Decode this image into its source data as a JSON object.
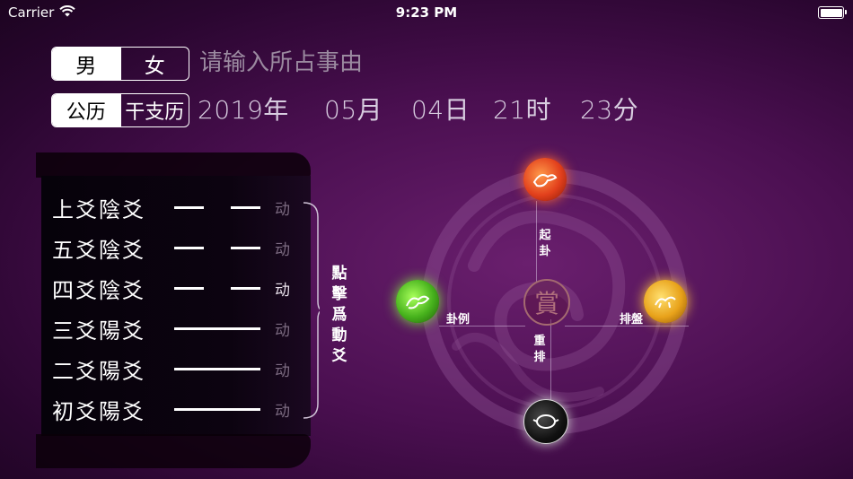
{
  "status_bar": {
    "carrier": "Carrier",
    "time": "9:23 PM"
  },
  "gender": {
    "options": [
      "男",
      "女"
    ],
    "selected": 0
  },
  "reason": {
    "placeholder": "请输入所占事由"
  },
  "calendar": {
    "options": [
      "公历",
      "干支历"
    ],
    "selected": 0
  },
  "date": {
    "year": "2019年",
    "month": "05月",
    "day": "04日",
    "hour": "21时",
    "minute": "23分"
  },
  "yao_lines": [
    {
      "name": "上爻陰爻",
      "type": "yin",
      "move_label": "动",
      "active": false
    },
    {
      "name": "五爻陰爻",
      "type": "yin",
      "move_label": "动",
      "active": false
    },
    {
      "name": "四爻陰爻",
      "type": "yin",
      "move_label": "动",
      "active": true
    },
    {
      "name": "三爻陽爻",
      "type": "yang",
      "move_label": "动",
      "active": false
    },
    {
      "name": "二爻陽爻",
      "type": "yang",
      "move_label": "动",
      "active": false
    },
    {
      "name": "初爻陽爻",
      "type": "yang",
      "move_label": "动",
      "active": false
    }
  ],
  "hint": {
    "text": "點擊爲動爻"
  },
  "actions": {
    "qigua": "起卦",
    "guali": "卦例",
    "paipan": "排盤",
    "chongpai": "重排",
    "center": "賞"
  },
  "colors": {
    "background": "#4a0f50",
    "accent_red": "#e2401c",
    "accent_green": "#46b11c",
    "accent_yellow": "#e8a21a"
  }
}
